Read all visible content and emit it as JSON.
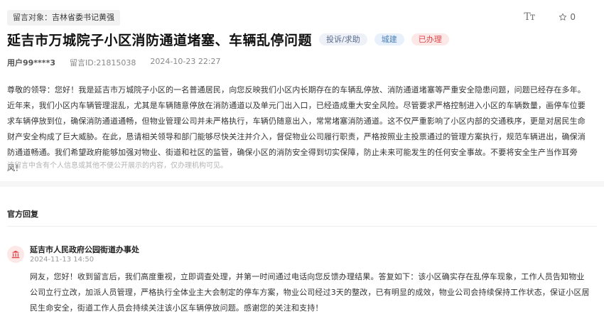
{
  "header": {
    "target_label": "留言对象：",
    "target_value": "吉林省委书记黄强",
    "font_toggle": "Tт",
    "star_count": "0"
  },
  "message": {
    "title": "延吉市万城院子小区消防通道堵塞、车辆乱停问题",
    "tags": {
      "type": "投诉/求助",
      "category": "城建",
      "status": "已办理"
    },
    "user": "用户99****3",
    "message_id": "留言ID:21815038",
    "datetime": "2024-10-23 22:27",
    "body": "尊敬的领导：您好！我是延吉市万城院子小区的一名普通居民，向您反映我们小区内长期存在的车辆乱停放、消防通道堵塞等严重安全隐患问题，问题已经存在多年。近年来，我们小区内车辆管理混乱，尤其是车辆随意停放在消防通道以及单元门出入口，已经造成重大安全风险。尽管要求严格控制进入小区的车辆数量，画停车位要求车辆停放到位，确保消防通道通畅，但物业管理公司并未严格执行，车辆仍随意出入，常常堵塞消防通道。这不仅严重影响了小区内部的交通秩序，更是对居民生命财产安全构成了巨大威胁。在此，恳请相关领导和部门能够尽快关注并介入，督促物业公司履行职责，严格按照业主投票通过的管理方案执行，规范车辆进出，确保消防通道畅通。我们希望政府能够加强对物业、街道和社区的监管，确保小区的消防安全得到切实保障，防止未来可能发生的任何安全事故。不要将安全生产当作耳旁风！",
    "note": "该留言中含有个人信息或其他不便公开展示的内容，仅办理机构可见。"
  },
  "reply": {
    "section_title": "官方回复",
    "department": "延吉市人民政府公园街道办事处",
    "datetime": "2024-11-13 14:50",
    "body": "网友，您好！收到留言后，我们高度重视，立即调查处理，并第一时间通过电话向您反馈办理结果。答复如下：该小区确实存在乱停车现象，工作人员告知物业公司立行立改，加派人员管理，严格执行全体业主大会制定的停车方案，物业公司经过3天的整改，已有明显的成效，物业公司会持续保持工作状态，保证小区居民生命安全，街道工作人员会持续关注该小区车辆停放问题。感谢您的关注和支持！"
  },
  "colors": {
    "status_red": "#e0474c",
    "tag_blue": "#4a7fb5"
  }
}
